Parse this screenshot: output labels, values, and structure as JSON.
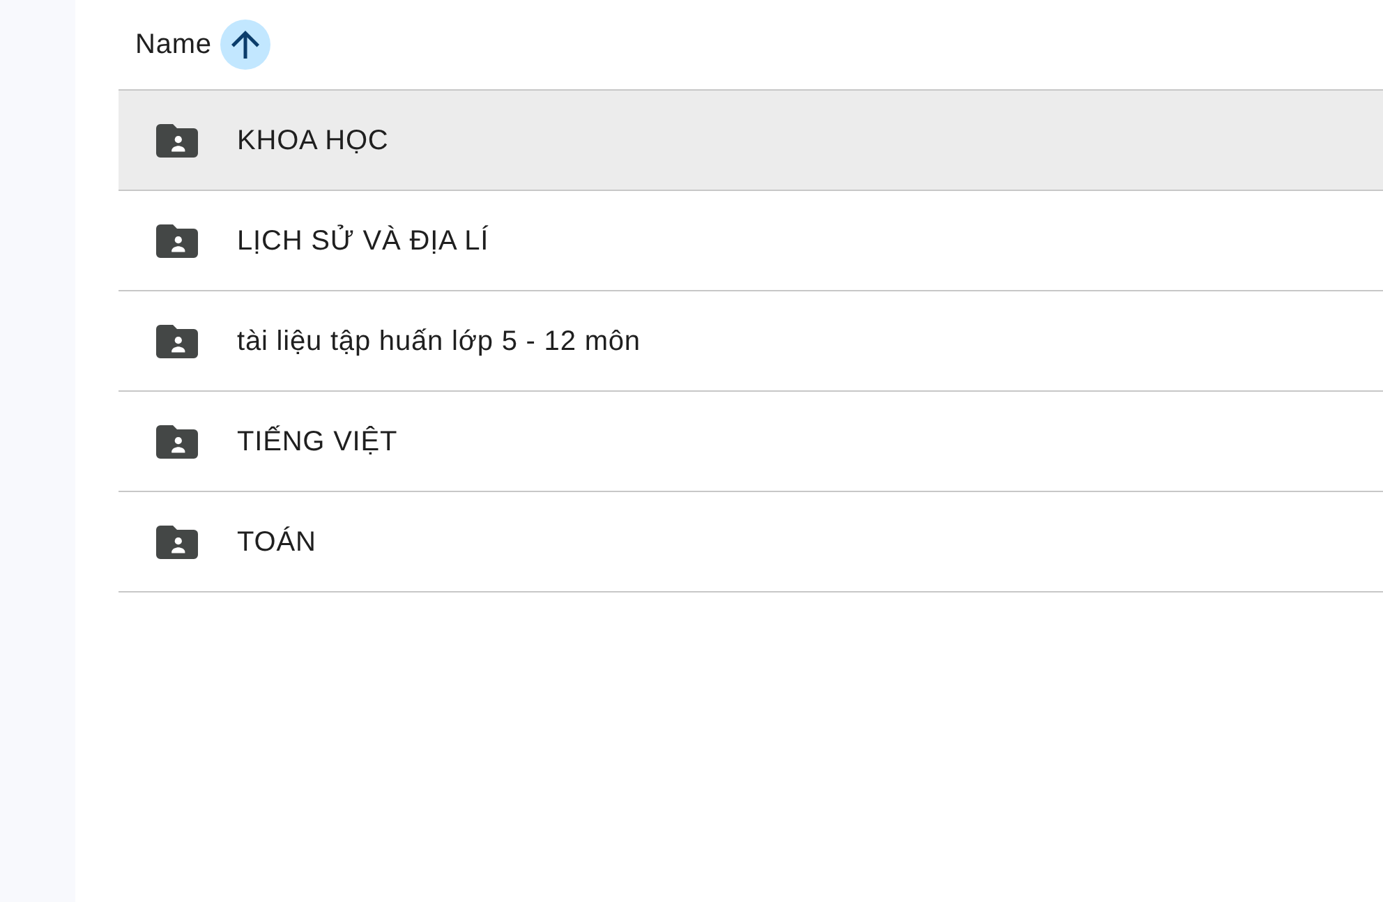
{
  "table": {
    "columns": [
      {
        "label": "Name",
        "sort_ascending": true
      }
    ],
    "rows": [
      {
        "name": "KHOA HỌC",
        "selected": true
      },
      {
        "name": "LỊCH SỬ VÀ ĐỊA LÍ",
        "selected": false
      },
      {
        "name": "tài liệu tập huấn lớp 5 - 12 môn",
        "selected": false
      },
      {
        "name": "TIẾNG VIỆT",
        "selected": false
      },
      {
        "name": "TOÁN",
        "selected": false
      }
    ]
  }
}
